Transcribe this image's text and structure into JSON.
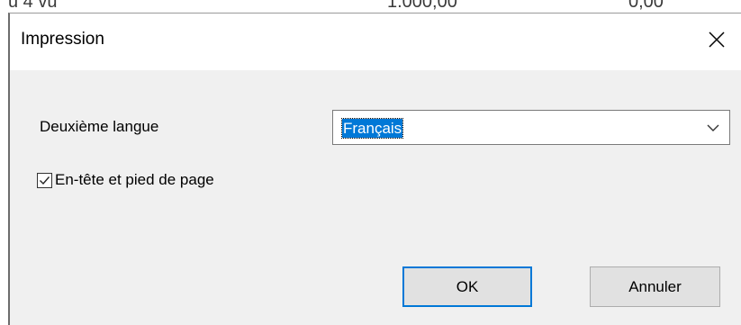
{
  "background_row": {
    "cell1": "u 4 vu",
    "cell2": "1.000,00",
    "cell3": "0,00"
  },
  "dialog": {
    "title": "Impression",
    "close_icon": "close-icon",
    "second_language": {
      "label": "Deuxième langue",
      "selected": "Français",
      "dropdown_icon": "chevron-down-icon"
    },
    "header_footer": {
      "label": "En-tête et pied de page",
      "checked": true,
      "check_icon": "checkmark-icon"
    },
    "buttons": {
      "ok": "OK",
      "cancel": "Annuler"
    }
  },
  "colors": {
    "selection": "#0078d7",
    "dialog_bg": "#f0f0f0",
    "button_bg": "#e1e1e1",
    "default_button_border": "#0078d7"
  }
}
